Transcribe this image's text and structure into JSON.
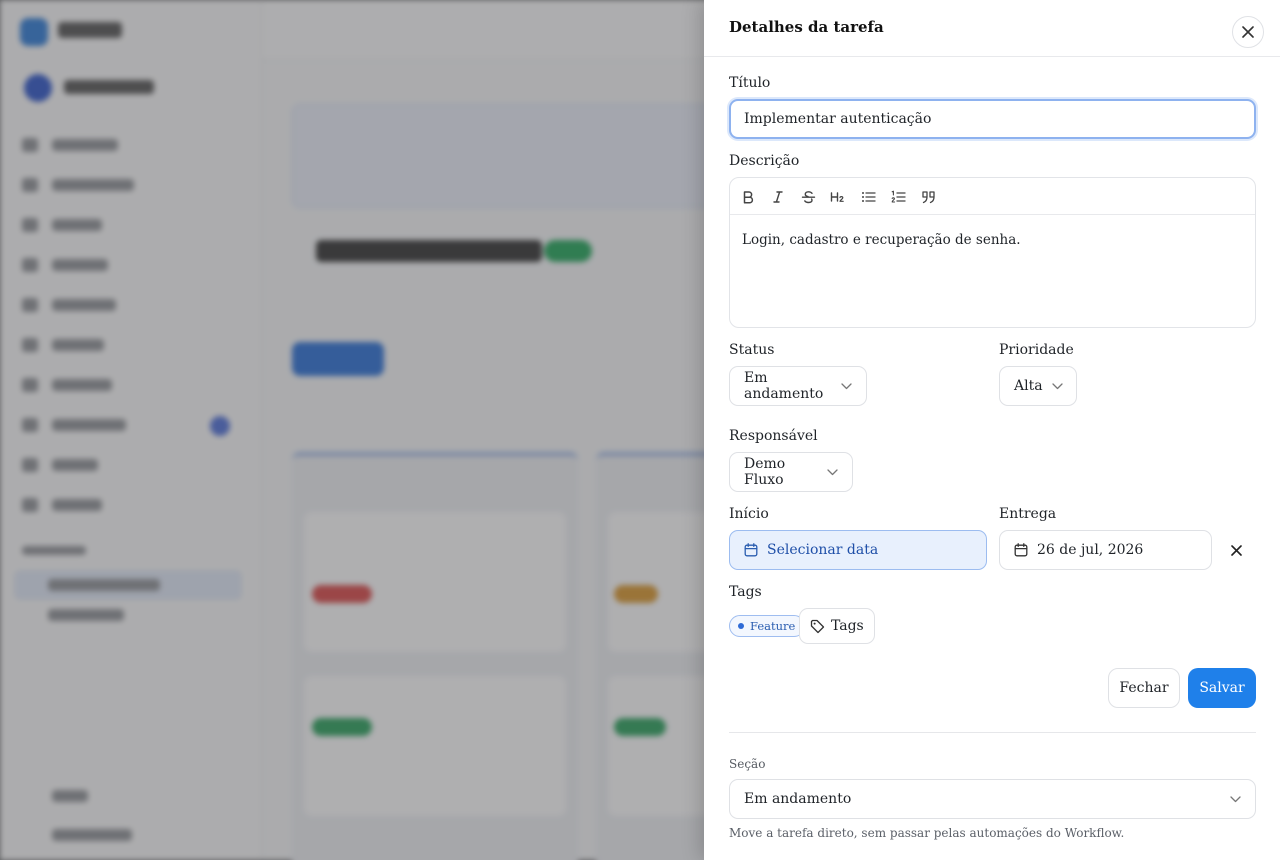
{
  "drawer": {
    "title": "Detalhes da tarefa",
    "close_icon": "close-icon"
  },
  "form": {
    "title_label": "Título",
    "title_value": "Implementar autenticação",
    "description_label": "Descrição",
    "description_toolbar": [
      "bold-icon",
      "italic-icon",
      "strikethrough-icon",
      "heading-2-icon",
      "bullet-list-icon",
      "ordered-list-icon",
      "quote-icon"
    ],
    "description_text": "Login, cadastro e recuperação de senha.",
    "status_label": "Status",
    "status_value": "Em andamento",
    "priority_label": "Prioridade",
    "priority_value": "Alta",
    "assignee_label": "Responsável",
    "assignee_value": "Demo Fluxo",
    "start_label": "Início",
    "start_value": "Selecionar data",
    "due_label": "Entrega",
    "due_value": "26 de jul, 2026",
    "tags_label": "Tags",
    "tags": [
      {
        "label": "Feature",
        "color": "#2f6bd6"
      }
    ],
    "tags_button": "Tags"
  },
  "actions": {
    "close_label": "Fechar",
    "save_label": "Salvar"
  },
  "section": {
    "label": "Seção",
    "value": "Em andamento",
    "help": "Move a tarefa direto, sem passar pelas automações do Workflow."
  },
  "colors": {
    "accent": "#1f80ea",
    "date_active_bg": "#e8f0fd"
  }
}
